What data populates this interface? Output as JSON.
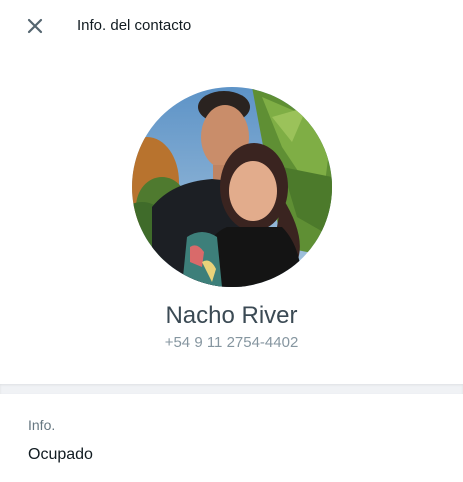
{
  "header": {
    "close_icon": "close-icon",
    "title": "Info. del contacto"
  },
  "profile": {
    "avatar_icon": "contact-photo",
    "name": "Nacho River",
    "phone": "+54 9 11 2754-4402"
  },
  "about": {
    "label": "Info.",
    "value": "Ocupado"
  },
  "colors": {
    "title_text": "#111b21",
    "name_text": "#3b4a54",
    "secondary_text": "#8696a0",
    "label_text": "#667781",
    "divider": "#f0f2f5"
  }
}
